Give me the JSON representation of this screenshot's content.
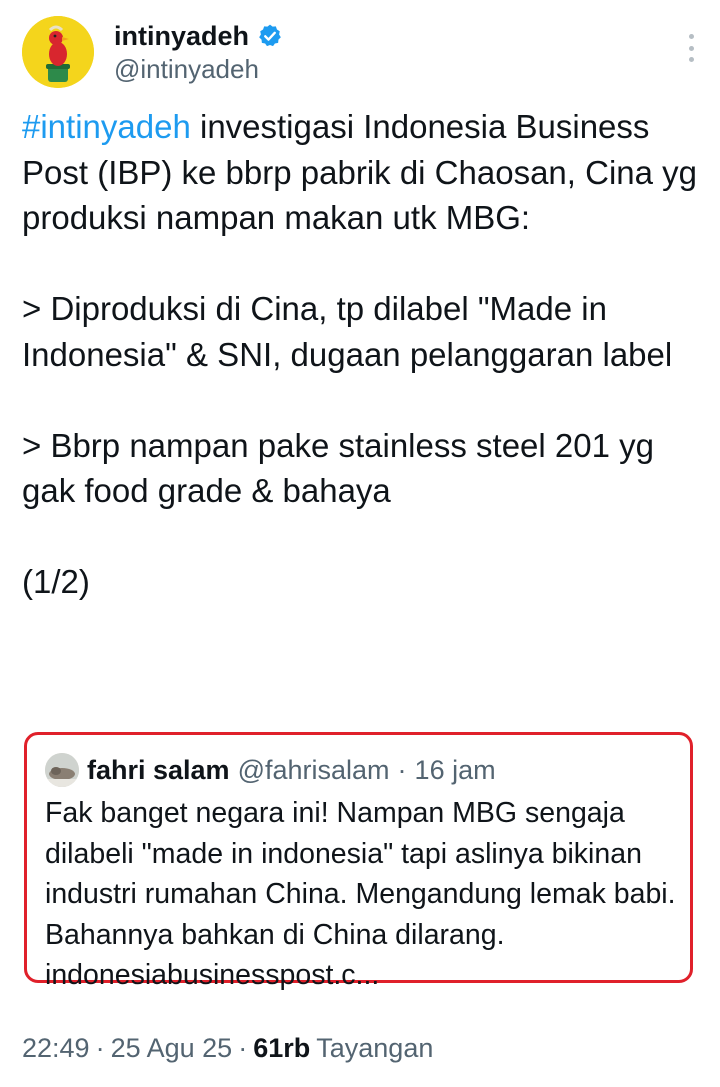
{
  "author": {
    "display_name": "intinyadeh",
    "handle": "@intinyadeh",
    "verified_icon": "verified-badge-icon",
    "avatar": "duck-toy-avatar"
  },
  "tweet": {
    "hashtag": "#intinyadeh",
    "line1_rest": " investigasi Indonesia Business Post (IBP) ke bbrp pabrik di Chaosan, Cina yg produksi nampan makan utk MBG:",
    "bullet1": "> Diproduksi di Cina, tp dilabel \"Made in Indonesia\" & SNI, dugaan pelanggaran label",
    "bullet2": "> Bbrp nampan pake stainless steel 201 yg gak food grade & bahaya",
    "thread_marker": "(1/2)"
  },
  "quoted": {
    "display_name": "fahri salam",
    "handle": "@fahrisalam",
    "separator": "·",
    "time": "16 jam",
    "text": "Fak banget negara ini! Nampan MBG sengaja dilabeli \"made in indonesia\" tapi aslinya bikinan industri rumahan China. Mengandung lemak babi. Bahannya bahkan di China dilarang. indonesiabusinesspost.c..."
  },
  "footer": {
    "time": "22:49",
    "sep1": "·",
    "date": "25 Agu 25",
    "sep2": "·",
    "views_count": "61rb",
    "views_label": "Tayangan"
  },
  "colors": {
    "link": "#1d9bf0",
    "secondary_text": "#536471",
    "highlight_border": "#e0202a",
    "verified": "#1d9bf0"
  }
}
